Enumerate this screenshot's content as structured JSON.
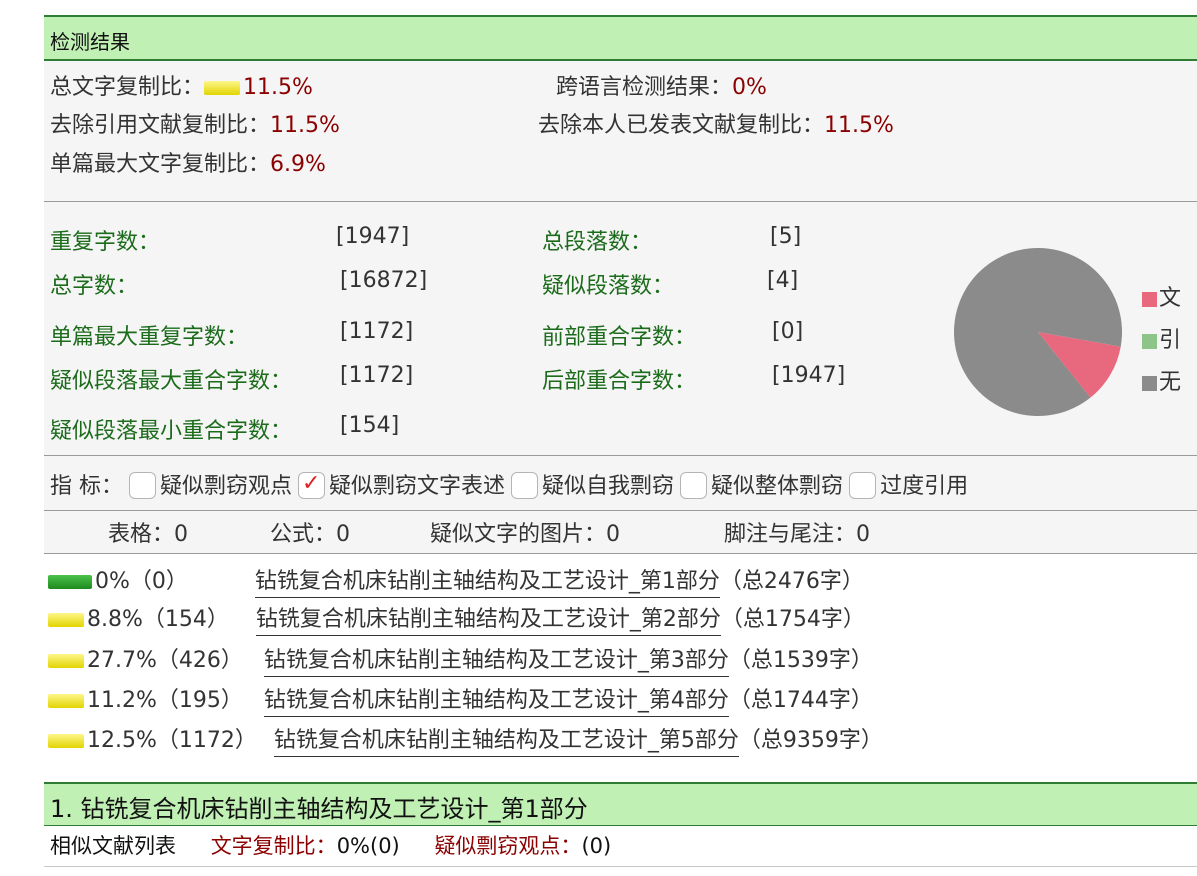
{
  "header": {
    "title": "检测结果"
  },
  "summary": {
    "total_copy_label": "总文字复制比：",
    "total_copy_value": "11.5%",
    "cross_lang_label": "跨语言检测结果：",
    "cross_lang_value": "0%",
    "excl_ref_label": "去除引用文献复制比：",
    "excl_ref_value": "11.5%",
    "excl_self_label": "去除本人已发表文献复制比：",
    "excl_self_value": "11.5%",
    "max_single_label": "单篇最大文字复制比：",
    "max_single_value": "6.9%"
  },
  "stats": {
    "dup_chars_label": "重复字数：",
    "dup_chars_value": "[1947]",
    "total_paras_label": "总段落数：",
    "total_paras_value": "[5]",
    "total_chars_label": "总字数：",
    "total_chars_value": "[16872]",
    "susp_paras_label": "疑似段落数：",
    "susp_paras_value": "[4]",
    "max_single_dup_label": "单篇最大重复字数：",
    "max_single_dup_value": "[1172]",
    "front_overlap_label": "前部重合字数：",
    "front_overlap_value": "[0]",
    "max_para_overlap_label": "疑似段落最大重合字数：",
    "max_para_overlap_value": "[1172]",
    "back_overlap_label": "后部重合字数：",
    "back_overlap_value": "[1947]",
    "min_para_overlap_label": "疑似段落最小重合字数：",
    "min_para_overlap_value": "[154]"
  },
  "chart_data": {
    "type": "pie",
    "slices": [
      {
        "legend": "文",
        "value": 11.5,
        "color": "#e8697e"
      },
      {
        "legend": "引",
        "value": 0,
        "color": "#8cc48a"
      },
      {
        "legend": "无",
        "value": 88.5,
        "color": "#8b8b8b"
      }
    ]
  },
  "indicators": {
    "label": "指  标：",
    "items": [
      {
        "label": "疑似剽窃观点",
        "checked": false
      },
      {
        "label": "疑似剽窃文字表述",
        "checked": true
      },
      {
        "label": "疑似自我剽窃",
        "checked": false
      },
      {
        "label": "疑似整体剽窃",
        "checked": false
      },
      {
        "label": "过度引用",
        "checked": false
      }
    ]
  },
  "counts": {
    "tables_label": "表格：",
    "tables_value": "0",
    "formulas_label": "公式：",
    "formulas_value": "0",
    "images_label": "疑似文字的图片：",
    "images_value": "0",
    "footnotes_label": "脚注与尾注：",
    "footnotes_value": "0"
  },
  "parts": [
    {
      "stat": "0%（0）",
      "title": "钻铣复合机床钻削主轴结构及工艺设计_第1部分",
      "total": "（总2476字）",
      "level": "green"
    },
    {
      "stat": "8.8%（154）",
      "title": "钻铣复合机床钻削主轴结构及工艺设计_第2部分",
      "total": "（总1754字）",
      "level": "yellow"
    },
    {
      "stat": "27.7%（426）",
      "title": "钻铣复合机床钻削主轴结构及工艺设计_第3部分",
      "total": "（总1539字）",
      "level": "yellow"
    },
    {
      "stat": "11.2%（195）",
      "title": "钻铣复合机床钻削主轴结构及工艺设计_第4部分",
      "total": "（总1744字）",
      "level": "yellow"
    },
    {
      "stat": "12.5%（1172）",
      "title": "钻铣复合机床钻削主轴结构及工艺设计_第5部分",
      "total": "（总9359字）",
      "level": "yellow"
    }
  ],
  "section1": {
    "title": "1. 钻铣复合机床钻削主轴结构及工艺设计_第1部分",
    "list_label": "相似文献列表",
    "copy_label": "文字复制比：",
    "copy_value": "0%(0)",
    "plag_label": "疑似剽窃观点：",
    "plag_value": "(0)"
  }
}
